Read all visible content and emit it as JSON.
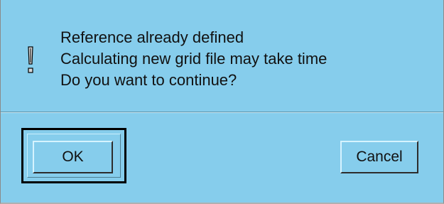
{
  "dialog": {
    "icon": "exclamation-icon",
    "message_lines": [
      "Reference already defined",
      "Calculating new grid file may take time",
      "Do you want to continue?"
    ],
    "buttons": {
      "ok_label": "OK",
      "cancel_label": "Cancel"
    },
    "colors": {
      "background": "#86cdec",
      "text": "#111111"
    }
  }
}
